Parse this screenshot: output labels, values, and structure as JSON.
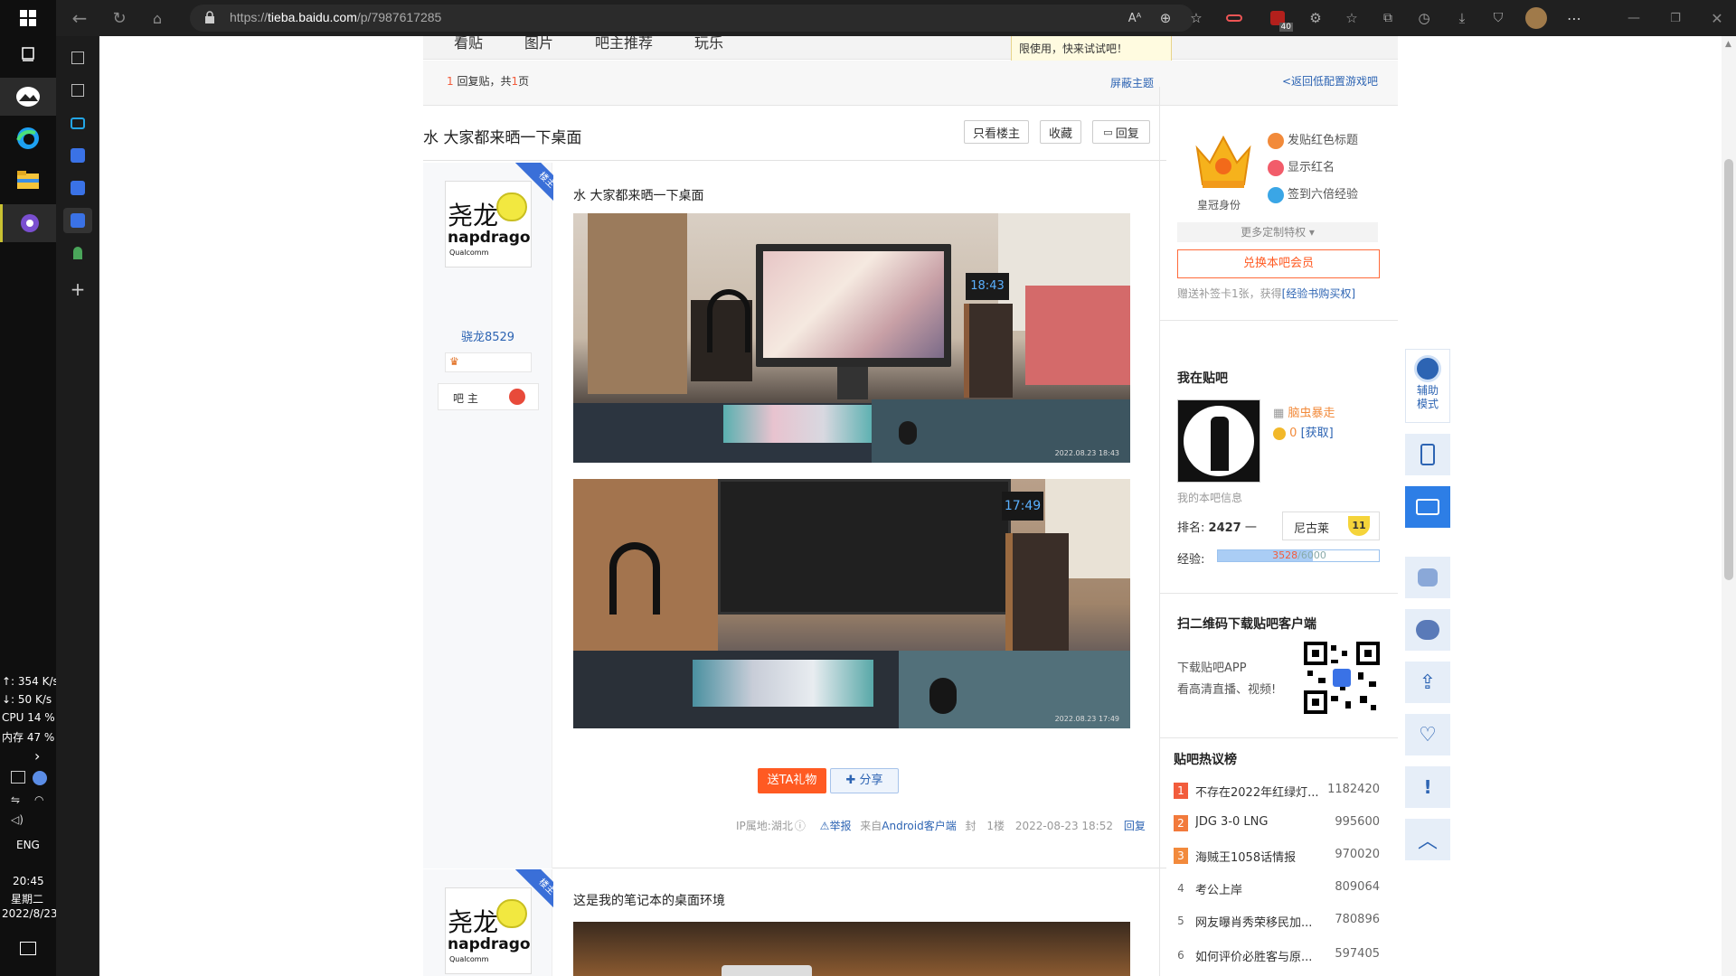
{
  "browser": {
    "url_prefix": "https://",
    "url_domain": "tieba.baidu.com",
    "url_path": "/p/7987617285"
  },
  "system": {
    "upload": "↑: 354 K/s",
    "download": "↓: 50 K/s",
    "cpu": "CPU 14 %",
    "memory": "内存 47 %",
    "lang": "ENG",
    "time": "20:45",
    "weekday": "星期二",
    "date": "2022/8/23",
    "badge_count": "40"
  },
  "tabs": [
    "看贴",
    "图片",
    "吧主推荐",
    "玩乐"
  ],
  "tooltip": "限使用，快来试试吧！",
  "pager": {
    "count": "1",
    "text_a": "回复贴，共",
    "pages": "1",
    "text_b": "页",
    "block": "屏蔽主题",
    "back": "<返回低配置游戏吧"
  },
  "thread": {
    "title": "水 大家都来晒一下桌面",
    "only_op": "只看楼主",
    "collect": "收藏",
    "reply": "回复"
  },
  "post1": {
    "user": "骁龙8529",
    "avatar_text1": "尧龙",
    "avatar_text2": "napdragon",
    "avatar_text3": "Qualcomm",
    "badge": "楼主",
    "role": "吧 主",
    "content": "水 大家都来晒一下桌面",
    "photo1_stamp": "2022.08.23 18:43",
    "photo2_stamp": "2022.08.23 17:49",
    "clock1": "18:43",
    "clock2": "17:49",
    "gift": "送TA礼物",
    "share": "分享",
    "ip": "IP属地:湖北",
    "report": "举报",
    "source_pre": "来自",
    "source": "Android客户端",
    "seal": "封",
    "floor": "1楼",
    "time": "2022-08-23 18:52",
    "reply": "回复"
  },
  "post2": {
    "content": "这是我的笔记本的桌面环境",
    "badge": "楼主"
  },
  "vip": {
    "label": "皇冠身份",
    "perks": [
      "发贴红色标题",
      "显示红名",
      "签到六倍经验"
    ],
    "more": "更多定制特权",
    "redeem": "兑换本吧会员",
    "note_a": "赠送补签卡1张，获得",
    "note_link": "[经验书购买权]"
  },
  "mine": {
    "title": "我在贴吧",
    "name": "脑虫暴走",
    "coins": "0",
    "get": "[获取]",
    "info": "我的本吧信息",
    "rank_label": "排名:",
    "rank": "2427",
    "rank_trend": "一",
    "level_name": "尼古莱",
    "level": "11",
    "exp_label": "经验:",
    "exp_cur": "3528",
    "exp_max": "6000",
    "exp_fraction": 0.588
  },
  "qr": {
    "title": "扫二维码下载贴吧客户端",
    "line1": "下载贴吧APP",
    "line2": "看高清直播、视频!"
  },
  "hot": {
    "title": "贴吧热议榜",
    "items": [
      {
        "rank": "1",
        "text": "不存在2022年红绿灯...",
        "count": "1182420"
      },
      {
        "rank": "2",
        "text": "JDG 3-0 LNG",
        "count": "995600"
      },
      {
        "rank": "3",
        "text": "海贼王1058话情报",
        "count": "970020"
      },
      {
        "rank": "4",
        "text": "考公上岸",
        "count": "809064"
      },
      {
        "rank": "5",
        "text": "网友曝肖秀荣移民加...",
        "count": "780896"
      },
      {
        "rank": "6",
        "text": "如何评价必胜客与原...",
        "count": "597405"
      }
    ]
  },
  "float": {
    "assist_line1": "辅助",
    "assist_line2": "模式"
  },
  "colors": {
    "accent": "#2d64b3",
    "orange": "#ff5a22",
    "hot_red": "#f25c3c"
  }
}
